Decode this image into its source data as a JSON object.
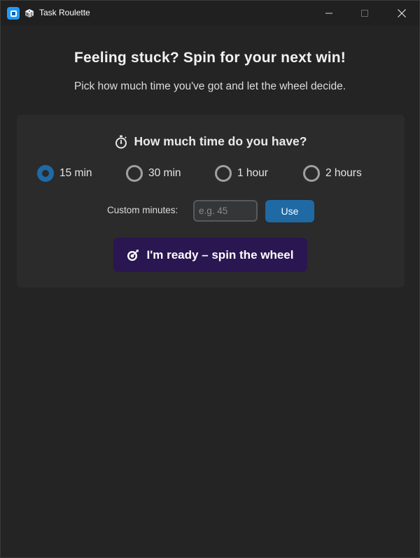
{
  "window": {
    "title": "Task Roulette",
    "icons": [
      "app-icon",
      "cube-icon"
    ],
    "controls": [
      "minimize-icon",
      "maximize-icon",
      "close-icon"
    ]
  },
  "header": {
    "headline": "Feeling stuck? Spin for your next win!",
    "subline": "Pick how much time you've got and let the wheel decide."
  },
  "panel": {
    "question": "How much time do you have?",
    "question_icon": "stopwatch-icon",
    "options": [
      {
        "label": "15 min",
        "selected": true
      },
      {
        "label": "30 min",
        "selected": false
      },
      {
        "label": "1 hour",
        "selected": false
      },
      {
        "label": "2 hours",
        "selected": false
      }
    ],
    "custom": {
      "label": "Custom minutes:",
      "placeholder": "e.g. 45",
      "value": "",
      "button": "Use"
    },
    "spin_button": {
      "label": "I'm ready – spin the wheel",
      "icon": "target-icon"
    }
  },
  "colors": {
    "background": "#242424",
    "panel": "#2b2b2b",
    "accent": "#1f6aa5",
    "spin_button": "#2a1650"
  }
}
